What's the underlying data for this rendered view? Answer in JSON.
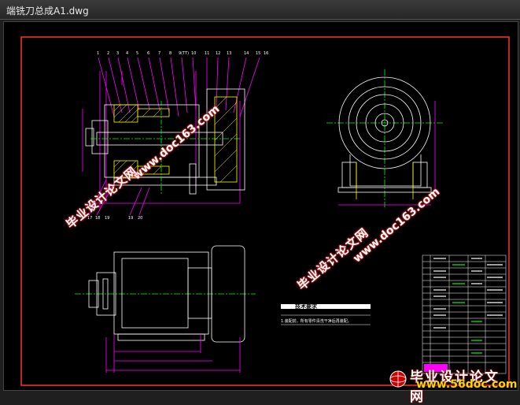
{
  "window": {
    "title": "端铣刀总成A1.dwg"
  },
  "top_balloons": [
    "1",
    "2",
    "3",
    "4",
    "5",
    "6",
    "7",
    "8",
    "9(TT)",
    "10",
    "11",
    "12",
    "13",
    "14",
    "15",
    "16"
  ],
  "bottom_balloons": [
    "17",
    "18",
    "19",
    "19",
    "20"
  ],
  "tech_requirements": {
    "title": "技术要求",
    "lines": [
      "1.装配前，所有零件清洗干净后再装配。"
    ]
  },
  "watermarks": {
    "cn_text": "毕业设计论文网",
    "url_text": "www.doc163.com"
  },
  "bottom_logo": {
    "cn_text": "毕业设计论文网",
    "url_text": "www.56doc.com"
  },
  "colors": {
    "background": "#000000",
    "outline": "#ffffff",
    "dimension": "#ff00ff",
    "centerline": "#00ff00",
    "hatch": "#ffff00",
    "frame": "#ff0000"
  }
}
